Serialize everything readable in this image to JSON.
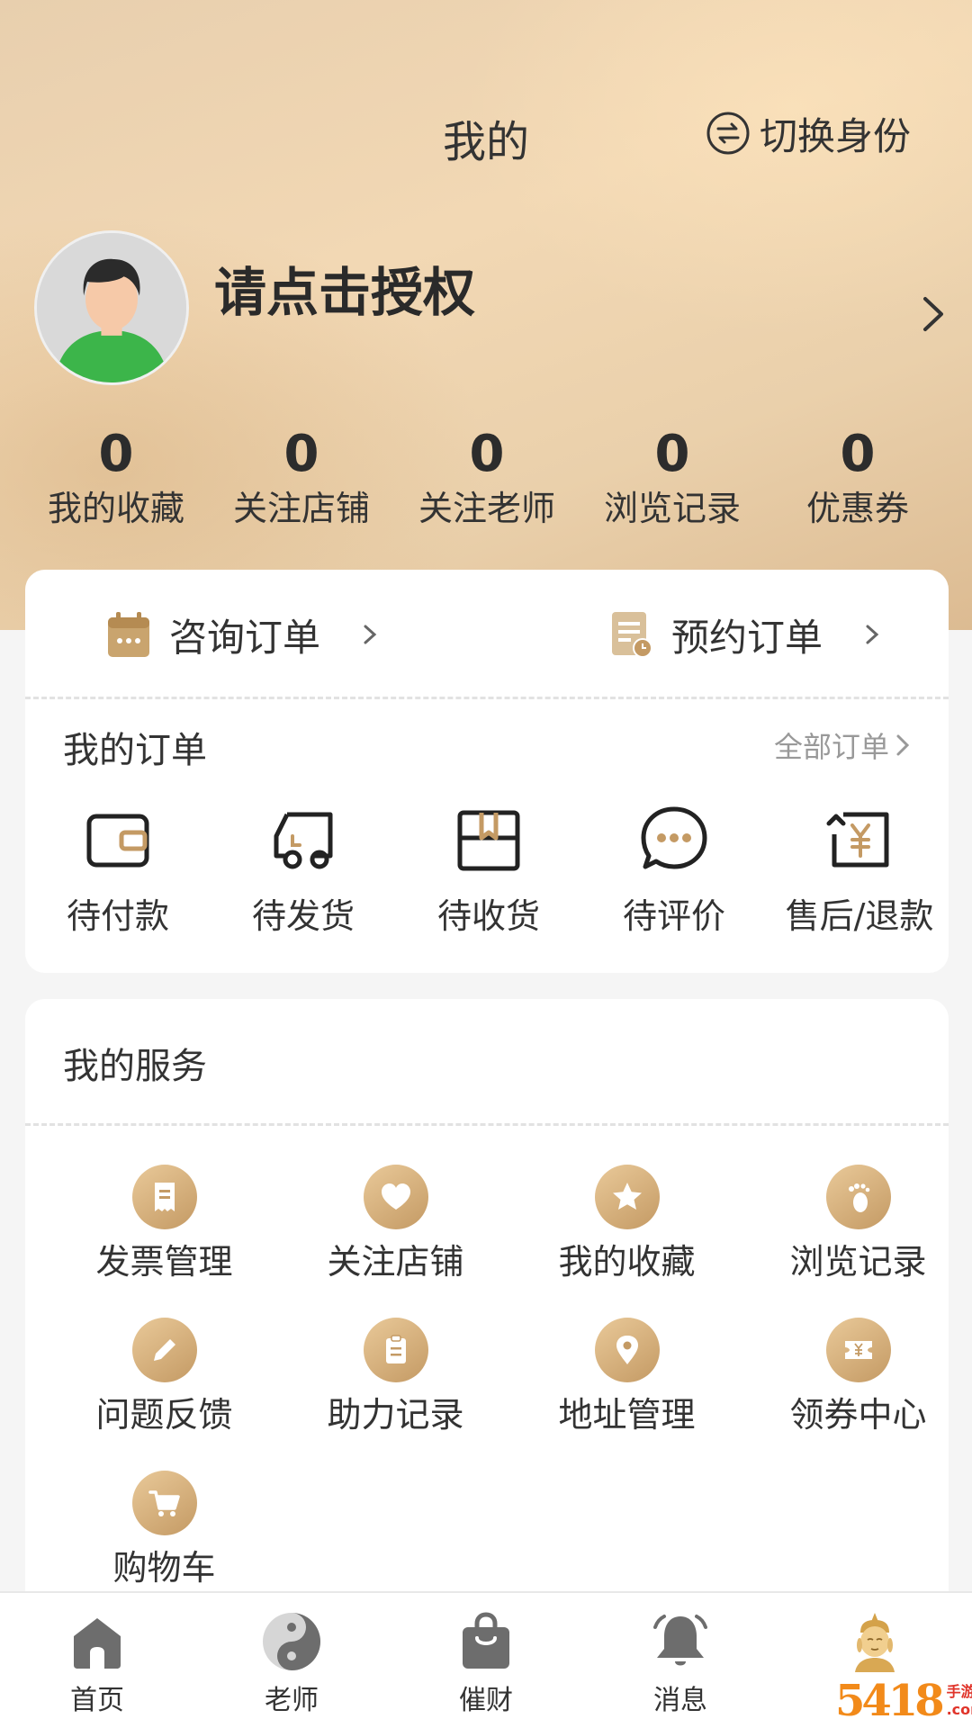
{
  "header": {
    "title": "我的",
    "switch_label": "切换身份"
  },
  "profile": {
    "name": "请点击授权"
  },
  "stats": [
    {
      "value": "0",
      "label": "我的收藏"
    },
    {
      "value": "0",
      "label": "关注店铺"
    },
    {
      "value": "0",
      "label": "关注老师"
    },
    {
      "value": "0",
      "label": "浏览记录"
    },
    {
      "value": "0",
      "label": "优惠券"
    }
  ],
  "quick_orders": [
    {
      "label": "咨询订单",
      "icon": "calendar-icon"
    },
    {
      "label": "预约订单",
      "icon": "document-clock-icon"
    }
  ],
  "orders": {
    "title": "我的订单",
    "all_label": "全部订单",
    "items": [
      {
        "label": "待付款",
        "icon": "wallet-icon"
      },
      {
        "label": "待发货",
        "icon": "truck-icon"
      },
      {
        "label": "待收货",
        "icon": "box-icon"
      },
      {
        "label": "待评价",
        "icon": "chat-bubble-icon"
      },
      {
        "label": "售后/退款",
        "icon": "refund-icon"
      }
    ]
  },
  "services": {
    "title": "我的服务",
    "items": [
      {
        "label": "发票管理",
        "icon": "receipt-icon"
      },
      {
        "label": "关注店铺",
        "icon": "heart-icon"
      },
      {
        "label": "我的收藏",
        "icon": "star-icon"
      },
      {
        "label": "浏览记录",
        "icon": "footprint-icon"
      },
      {
        "label": "问题反馈",
        "icon": "pencil-icon"
      },
      {
        "label": "助力记录",
        "icon": "clipboard-icon"
      },
      {
        "label": "地址管理",
        "icon": "location-pin-icon"
      },
      {
        "label": "领券中心",
        "icon": "coupon-icon"
      },
      {
        "label": "购物车",
        "icon": "cart-icon"
      }
    ]
  },
  "tabbar": [
    {
      "label": "首页",
      "icon": "home-icon"
    },
    {
      "label": "老师",
      "icon": "yin-yang-icon"
    },
    {
      "label": "催财",
      "icon": "shopping-bag-icon"
    },
    {
      "label": "消息",
      "icon": "bell-icon"
    },
    {
      "label": "",
      "icon": "buddha-icon"
    }
  ],
  "watermark": {
    "main": "5418",
    "top": "手游网",
    "bottom": ".com.cn"
  },
  "colors": {
    "gold": "#c49a64",
    "gold_light": "#e9c999",
    "text": "#333333",
    "muted": "#999999"
  }
}
